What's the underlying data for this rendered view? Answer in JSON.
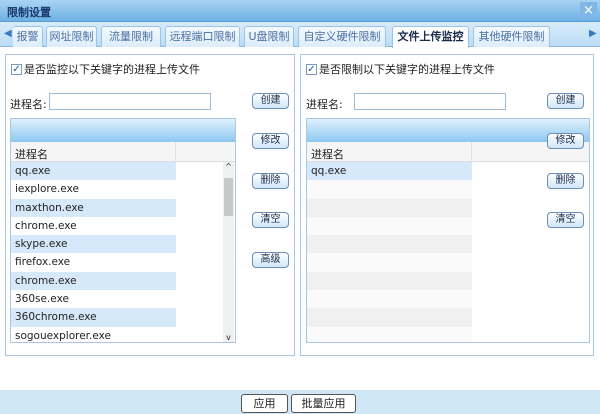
{
  "window": {
    "title": "限制设置",
    "close": "×"
  },
  "tabs": [
    "报警",
    "网址限制",
    "流量限制",
    "远程端口限制",
    "U盘限制",
    "自定义硬件限制",
    "文件上传监控",
    "其他硬件限制"
  ],
  "active_tab": "文件上传监控",
  "left": {
    "checkbox_label": "是否监控以下关键字的进程上传文件",
    "checked": true,
    "input_label": "进程名:",
    "input_value": "",
    "column_header": "进程名",
    "rows": [
      "qq.exe",
      "iexplore.exe",
      "maxthon.exe",
      "chrome.exe",
      "skype.exe",
      "firefox.exe",
      "chrome.exe",
      "360se.exe",
      "360chrome.exe",
      "sogouexplorer.exe"
    ],
    "buttons": [
      "创建",
      "修改",
      "删除",
      "清空",
      "高级"
    ]
  },
  "right": {
    "checkbox_label": "是否限制以下关键字的进程上传文件",
    "checked": true,
    "input_label": "进程名:",
    "input_value": "",
    "column_header": "进程名",
    "rows": [
      "qq.exe"
    ],
    "buttons": [
      "创建",
      "修改",
      "删除",
      "清空"
    ]
  },
  "footer": {
    "apply": "应用",
    "batch_apply": "批量应用"
  }
}
